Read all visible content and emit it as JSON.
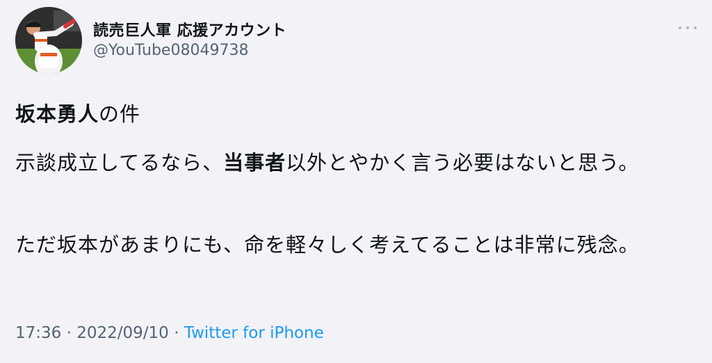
{
  "author": {
    "display_name": "読売巨人軍 応援アカウント",
    "handle": "@YouTube08049738"
  },
  "icons": {
    "avatar": "baseball-player-avatar",
    "more": "more-options-icon"
  },
  "tweet": {
    "p1_bold": "坂本勇人",
    "p1_rest": "の件",
    "p2_before": "示談成立してるなら、",
    "p2_bold": "当事者",
    "p2_after": "以外とやかく言う必要はないと思う。",
    "p3": "ただ坂本があまりにも、命を軽々しく考えてることは非常に残念。"
  },
  "meta": {
    "time": "17:36",
    "sep1": " · ",
    "date": "2022/09/10",
    "sep2": " · ",
    "source": "Twitter for iPhone"
  },
  "colors": {
    "background": "#f2f2f7",
    "text": "#0f1419",
    "secondary": "#536471",
    "link": "#1d9bf0"
  }
}
